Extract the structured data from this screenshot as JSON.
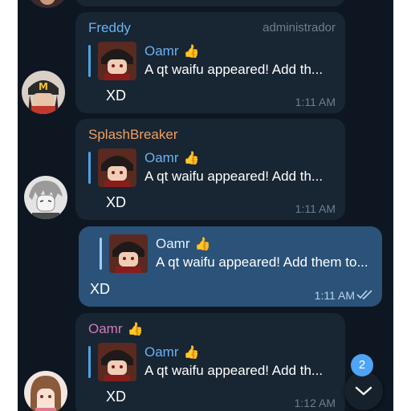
{
  "messages": [
    {
      "sender": "Freddy",
      "role": "administrador",
      "reply_name": "Oamr",
      "reply_text": "A qt waifu appeared! Add th...",
      "text": "XD",
      "time": "1:11 AM",
      "sender_color": "#6ab3f3"
    },
    {
      "sender": "SplashBreaker",
      "reply_name": "Oamr",
      "reply_text": "A qt waifu appeared! Add th...",
      "text": "XD",
      "time": "1:11 AM",
      "sender_color": "#f0a060"
    },
    {
      "outgoing": true,
      "reply_name": "Oamr",
      "reply_text": "A qt waifu appeared! Add them to...",
      "text": "XD",
      "time": "1:11 AM",
      "status_icon": "double-check-icon"
    },
    {
      "sender": "Oamr",
      "reply_name": "Oamr",
      "reply_text": "A qt waifu appeared! Add th...",
      "text": "XD",
      "time": "1:12 AM",
      "sender_color": "#d27ab8"
    }
  ],
  "scroll_down": {
    "unread_count": "2",
    "icon": "chevron-down-icon"
  },
  "colors": {
    "chat_background": "#0e1621",
    "incoming_bubble": "#182533",
    "outgoing_bubble": "#2b5278",
    "accent": "#4ea4f6"
  }
}
